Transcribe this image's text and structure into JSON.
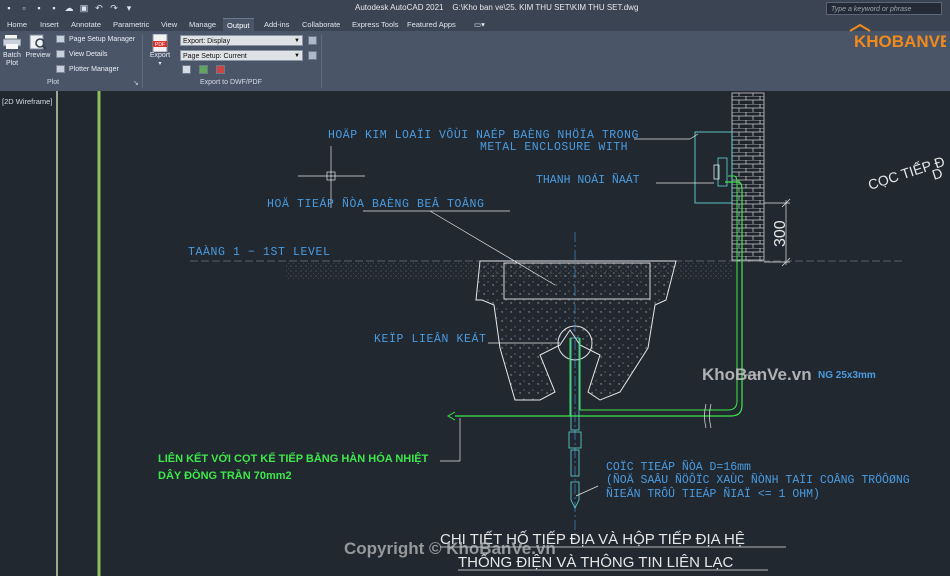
{
  "app": {
    "title": "Autodesk AutoCAD 2021",
    "file_path": "G:\\Kho ban ve\\25. KIM THU SET\\KIM THU SET.dwg",
    "search_placeholder": "Type a keyword or phrase"
  },
  "quick_access_icons": [
    "new-icon",
    "open-icon",
    "save-icon",
    "save-as-icon",
    "cloud-icon",
    "plot-icon",
    "undo-icon",
    "redo-icon",
    "dropdown-icon"
  ],
  "tabs": [
    {
      "label": "Home",
      "active": false
    },
    {
      "label": "Insert",
      "active": false
    },
    {
      "label": "Annotate",
      "active": false
    },
    {
      "label": "Parametric",
      "active": false
    },
    {
      "label": "View",
      "active": false
    },
    {
      "label": "Manage",
      "active": false
    },
    {
      "label": "Output",
      "active": true
    },
    {
      "label": "Add-ins",
      "active": false
    },
    {
      "label": "Collaborate",
      "active": false
    },
    {
      "label": "Express Tools",
      "active": false
    },
    {
      "label": "Featured Apps",
      "active": false
    }
  ],
  "ribbon": {
    "plot_panel": {
      "batch_plot": "Batch\nPlot",
      "preview": "Preview",
      "page_setup_manager": "Page Setup Manager",
      "view_details": "View Details",
      "plotter_manager": "Plotter Manager",
      "label": "Plot"
    },
    "export_panel": {
      "export": "Export",
      "pdf_icon_text": "PDF",
      "export_display": "Export: Display",
      "page_setup": "Page Setup: Current",
      "label": "Export to DWF/PDF"
    }
  },
  "logo": {
    "text": "KHOBANVE"
  },
  "viewport": {
    "label": "[2D Wireframe]"
  },
  "drawing": {
    "note_enclosure_1": "HOÄP KIM LOAÏI VÔÙI NAÉP BAÈNG NHÖÏA TRONG",
    "note_enclosure_2": "METAL ENCLOSURE WITH",
    "note_bar": "THANH NOÁI ÑAÁT",
    "note_cover": "HOÄ TIEÁP ÑÒA BAÈNG BEÂ TOÂNG",
    "level": "TAÀNG 1 − 1ST LEVEL",
    "note_clamp": "KEÏP LIEÂN KEÁT",
    "dim_300": "300",
    "top_right": "CỌC TIẾP Đ",
    "top_right_2": "D",
    "watermark_mid": "KhoBanVe.vn",
    "copper_tape": "NG 25x3mm",
    "green_note_1": "LIÊN KẾT VỚI CỌT KẾ TIẾP BẰNG HÀN HÓA NHIỆT",
    "green_note_2": "DÂY ĐỒNG TRẦN 70mm2",
    "rod_1": "COÏC TIEÁP ÑÒA D=16mm",
    "rod_2": "(ÑOÄ SAÂU ÑÖÔÏC XAÙC ÑÒNH TAÏI COÂNG TRÖÔØNG",
    "rod_3": "ÑIEÄN TRÔÛ TIEÁP ÑIAÏ <= 1 OHM)",
    "title_1": "CHI TIẾT HỐ TIẾP ĐỊA VÀ HỘP TIẾP ĐỊA HỆ",
    "title_2": "THỐNG ĐIỆN VÀ THÔNG TIN LIÊN LẠC",
    "copyright": "Copyright © KhoBanVe.vn"
  },
  "colors": {
    "ribbon_bg": "#4a5568",
    "canvas_bg": "#212830",
    "cad_blue": "#4a9be0",
    "cad_green": "#3ee84a",
    "cad_cyan": "#62d6d6",
    "cad_white": "#e6e6e6",
    "logo_orange": "#f08a1c"
  }
}
